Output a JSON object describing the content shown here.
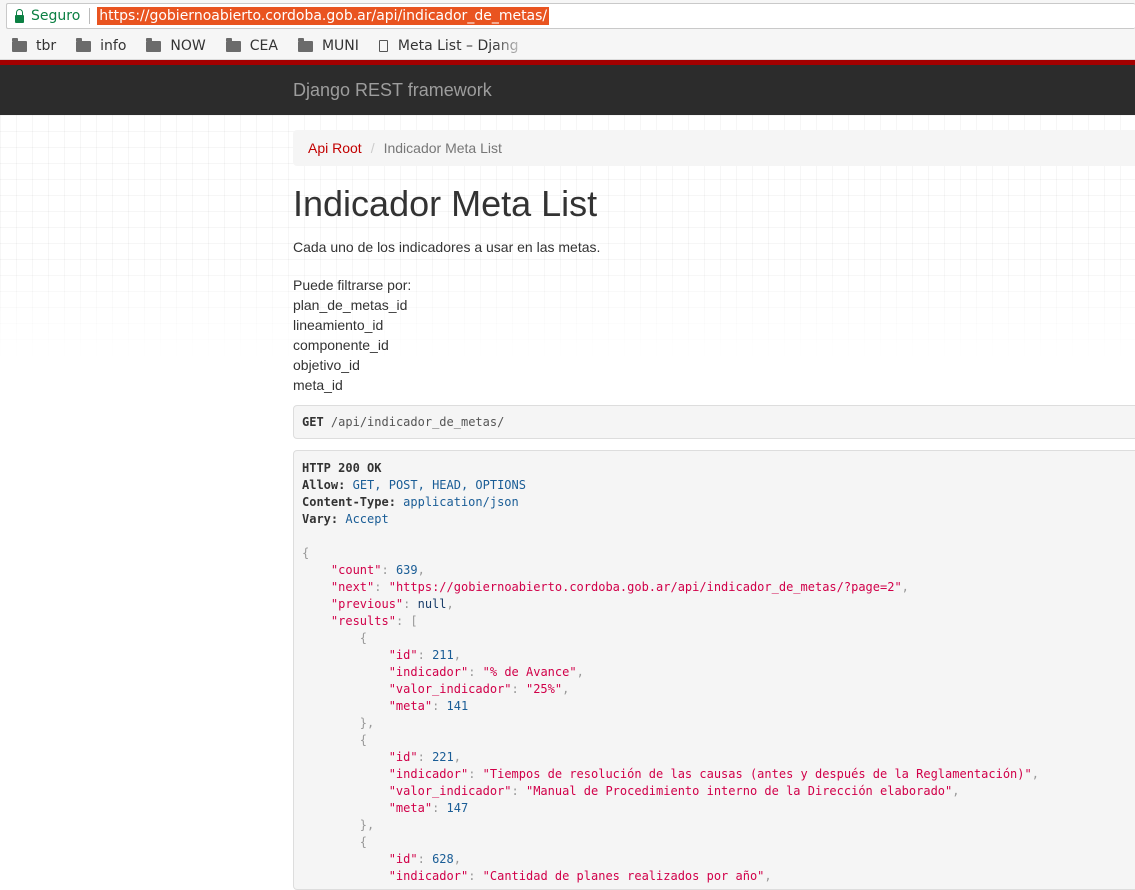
{
  "browser": {
    "secure_label": "Seguro",
    "url": "https://gobiernoabierto.cordoba.gob.ar/api/indicador_de_metas/",
    "bookmarks": [
      {
        "label": "tbr",
        "icon": "folder-icon"
      },
      {
        "label": "info",
        "icon": "folder-icon"
      },
      {
        "label": "NOW",
        "icon": "folder-icon"
      },
      {
        "label": "CEA",
        "icon": "folder-icon"
      },
      {
        "label": "MUNI",
        "icon": "folder-icon"
      },
      {
        "label": "Meta List – Djang",
        "icon": "page-icon"
      }
    ]
  },
  "navbar": {
    "brand": "Django REST framework"
  },
  "breadcrumb": {
    "root": "Api Root",
    "divider": "/",
    "current": "Indicador Meta List"
  },
  "page": {
    "title": "Indicador Meta List",
    "description": "Cada uno de los indicadores a usar en las metas.",
    "filter_heading": "Puede filtrarse por:",
    "filters": [
      "plan_de_metas_id",
      "lineamiento_id",
      "componente_id",
      "objetivo_id",
      "meta_id"
    ]
  },
  "request": {
    "method": "GET",
    "path": "/api/indicador_de_metas/"
  },
  "response": {
    "status": "HTTP 200 OK",
    "headers": [
      {
        "name": "Allow:",
        "value": "GET, POST, HEAD, OPTIONS"
      },
      {
        "name": "Content-Type:",
        "value": "application/json"
      },
      {
        "name": "Vary:",
        "value": "Accept"
      }
    ],
    "body": {
      "count": "639",
      "next": "\"https://gobiernoabierto.cordoba.gob.ar/api/indicador_de_metas/?page=2\"",
      "previous": "null",
      "results": [
        {
          "id": "211",
          "indicador": "\"% de Avance\"",
          "valor_indicador": "\"25%\"",
          "meta": "141"
        },
        {
          "id": "221",
          "indicador": "\"Tiempos de resolución de las causas (antes y después de la Reglamentación)\"",
          "valor_indicador": "\"Manual de Procedimiento interno de la Dirección elaborado\"",
          "meta": "147"
        },
        {
          "id": "628",
          "indicador": "\"Cantidad de planes realizados por año\""
        }
      ]
    }
  }
}
